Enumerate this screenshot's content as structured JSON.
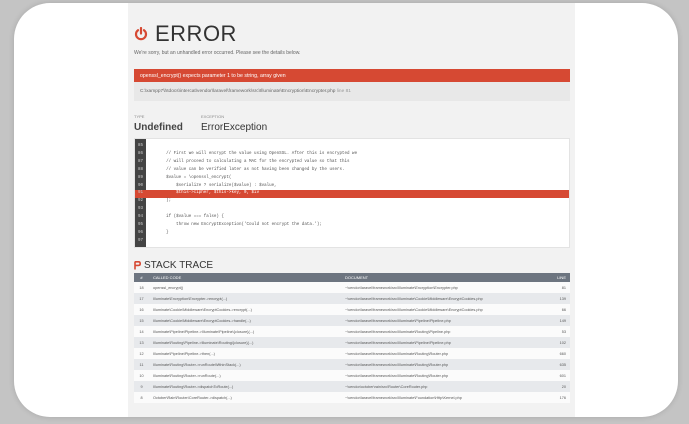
{
  "header": {
    "title": "ERROR",
    "subtitle": "We're sorry, but an unhandled error occurred. Please see the details below.",
    "icon": "power-icon"
  },
  "error": {
    "message": "openssl_encrypt() expects parameter 1 to be string, array given",
    "path": "C:\\xampp7\\htdocs\\intercat\\vendor\\laravel\\framework\\src\\Illuminate\\Encryption\\Encrypter.php",
    "line_label": "line 81"
  },
  "meta": {
    "type_label": "TYPE",
    "type_value": "Undefined",
    "exception_label": "EXCEPTION",
    "exception_value": "ErrorException"
  },
  "code": [
    {
      "n": "85",
      "text": ""
    },
    {
      "n": "86",
      "text": "        // First we will encrypt the value using OpenSSL. After this is encrypted we"
    },
    {
      "n": "87",
      "text": "        // will proceed to calculating a MAC for the encrypted value so that this"
    },
    {
      "n": "88",
      "text": "        // value can be verified later as not having been changed by the users."
    },
    {
      "n": "89",
      "text": "        $value = \\openssl_encrypt("
    },
    {
      "n": "90",
      "text": "            $serialize ? serialize($value) : $value,"
    },
    {
      "n": "91",
      "text": "            $this->cipher, $this->key, 0, $iv",
      "hl": true
    },
    {
      "n": "92",
      "text": "        );"
    },
    {
      "n": "93",
      "text": ""
    },
    {
      "n": "94",
      "text": "        if ($value === false) {"
    },
    {
      "n": "95",
      "text": "            throw new EncryptException('Could not encrypt the data.');"
    },
    {
      "n": "96",
      "text": "        }"
    },
    {
      "n": "97",
      "text": ""
    }
  ],
  "stack": {
    "title": "STACK TRACE",
    "headers": {
      "num": "#",
      "code": "CALLED CODE",
      "doc": "DOCUMENT",
      "line": "LINE"
    },
    "rows": [
      {
        "num": "18",
        "code": "openssl_encrypt()",
        "doc": "~\\vendor\\laravel\\framework\\src\\Illuminate\\Encryption\\Encrypter.php",
        "line": "81"
      },
      {
        "num": "17",
        "code": "Illuminate\\Encryption\\Encrypter->encrypt(...)",
        "doc": "~\\vendor\\laravel\\framework\\src\\Illuminate\\Cookie\\Middleware\\EncryptCookies.php",
        "line": "139"
      },
      {
        "num": "16",
        "code": "Illuminate\\Cookie\\Middleware\\EncryptCookies->encrypt(...)",
        "doc": "~\\vendor\\laravel\\framework\\src\\Illuminate\\Cookie\\Middleware\\EncryptCookies.php",
        "line": "66"
      },
      {
        "num": "15",
        "code": "Illuminate\\Cookie\\Middleware\\EncryptCookies->handle(...)",
        "doc": "~\\vendor\\laravel\\framework\\src\\Illuminate\\Pipeline\\Pipeline.php",
        "line": "149"
      },
      {
        "num": "14",
        "code": "Illuminate\\Pipeline\\Pipeline->Illuminate\\Pipeline\\{closure}(...)",
        "doc": "~\\vendor\\laravel\\framework\\src\\Illuminate\\Routing\\Pipeline.php",
        "line": "53"
      },
      {
        "num": "13",
        "code": "Illuminate\\Routing\\Pipeline->Illuminate\\Routing\\{closure}(...)",
        "doc": "~\\vendor\\laravel\\framework\\src\\Illuminate\\Pipeline\\Pipeline.php",
        "line": "102"
      },
      {
        "num": "12",
        "code": "Illuminate\\Pipeline\\Pipeline->then(...)",
        "doc": "~\\vendor\\laravel\\framework\\src\\Illuminate\\Routing\\Router.php",
        "line": "660"
      },
      {
        "num": "11",
        "code": "Illuminate\\Routing\\Router->runRouteWithinStack(...)",
        "doc": "~\\vendor\\laravel\\framework\\src\\Illuminate\\Routing\\Router.php",
        "line": "635"
      },
      {
        "num": "10",
        "code": "Illuminate\\Routing\\Router->runRoute(...)",
        "doc": "~\\vendor\\laravel\\framework\\src\\Illuminate\\Routing\\Router.php",
        "line": "601"
      },
      {
        "num": "9",
        "code": "Illuminate\\Routing\\Router->dispatchToRoute(...)",
        "doc": "~\\vendor\\october\\rain\\src\\Router\\CoreRouter.php",
        "line": "20"
      },
      {
        "num": "8",
        "code": "October\\Rain\\Router\\CoreRouter->dispatch(...)",
        "doc": "~\\vendor\\laravel\\framework\\src\\Illuminate\\Foundation\\Http\\Kernel.php",
        "line": "176"
      }
    ]
  },
  "colors": {
    "accent": "#d64933",
    "table_header": "#6d7580",
    "background": "#f2f2f2"
  }
}
